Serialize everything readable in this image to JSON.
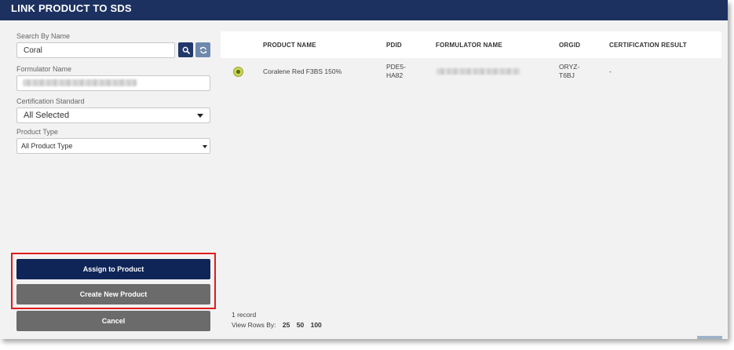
{
  "modal": {
    "title": "LINK PRODUCT TO SDS"
  },
  "filters": {
    "search_by_name": {
      "label": "Search By Name",
      "value": "Coral"
    },
    "formulator_name": {
      "label": "Formulator Name",
      "value": ""
    },
    "certification_standard": {
      "label": "Certification Standard",
      "value": "All Selected"
    },
    "product_type": {
      "label": "Product Type",
      "value": "All Product Type"
    },
    "search_icon": "magnifier-icon",
    "refresh_icon": "refresh-icon"
  },
  "actions": {
    "assign": "Assign to Product",
    "create": "Create New Product",
    "cancel": "Cancel"
  },
  "table": {
    "columns": [
      "PRODUCT NAME",
      "PDID",
      "FORMULATOR NAME",
      "ORGID",
      "CERTIFICATION RESULT"
    ],
    "rows": [
      {
        "product_name": "Coralene Red F3BS 150%",
        "pdid_line1": "PDE5-",
        "pdid_line2": "HA82",
        "orgid_line1": "ORYZ-",
        "orgid_line2": "T6BJ",
        "certification_result": "-"
      }
    ]
  },
  "footer": {
    "record_count": "1 record",
    "view_rows_label": "View Rows By:",
    "row_options": [
      "25",
      "50",
      "100"
    ]
  },
  "colors": {
    "header_bg": "#1c3160",
    "primary_button": "#0f2557",
    "secondary_button": "#6b6b6b",
    "highlight_border": "#e01b1b",
    "radio_selected": "#c8d35a"
  }
}
